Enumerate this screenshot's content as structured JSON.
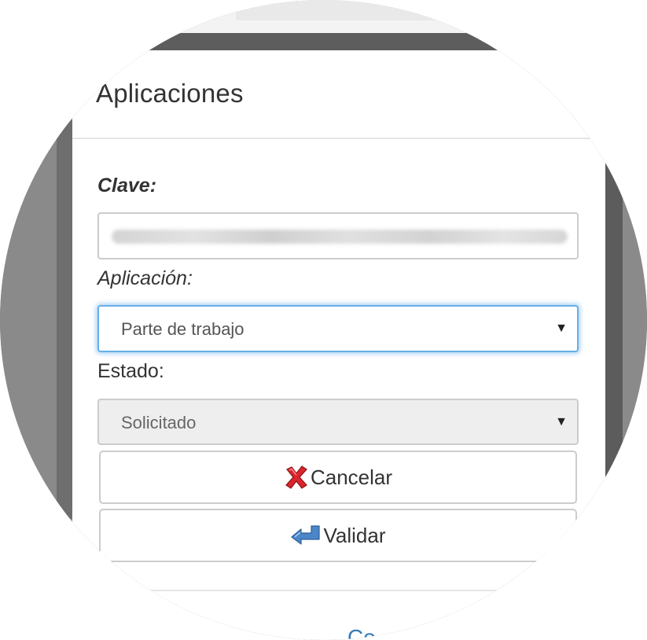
{
  "modal": {
    "title": "Aplicaciones",
    "clave_label": "Clave:",
    "aplicacion_label": "Aplicación:",
    "aplicacion_value": "Parte de trabajo",
    "estado_label": "Estado:",
    "estado_value": "Solicitado",
    "cancel_label": "Cancelar",
    "validar_label": "Validar",
    "footer_link": "Co"
  },
  "icons": {
    "cancel": "red-x-icon",
    "validar": "blue-return-arrow-icon",
    "dropdown": "triangle-down-icon"
  },
  "colors": {
    "focus_border": "#66afe9",
    "link": "#337ab7",
    "cancel_icon": "#d9262c",
    "validar_icon": "#4a86c8"
  }
}
